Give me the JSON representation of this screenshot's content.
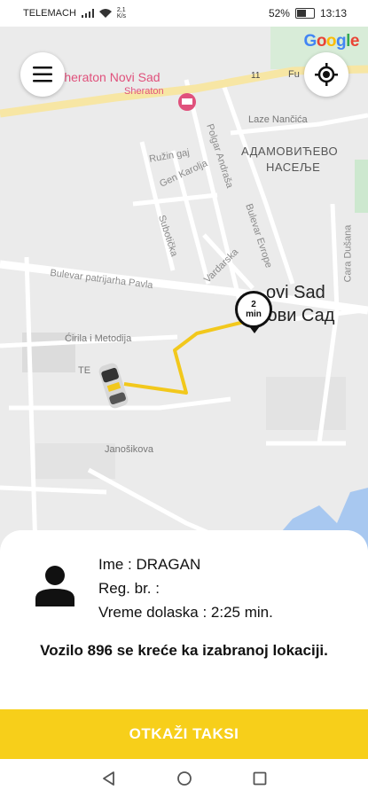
{
  "status_bar": {
    "carrier": "TELEMACH",
    "speed_value": "2,1",
    "speed_unit": "K/s",
    "battery": "52%",
    "time": "13:13"
  },
  "map": {
    "google_logo": {
      "letters": [
        {
          "char": "G",
          "color": "#4285F4"
        },
        {
          "char": "o",
          "color": "#EA4335"
        },
        {
          "char": "o",
          "color": "#FBBC05"
        },
        {
          "char": "g",
          "color": "#4285F4"
        },
        {
          "char": "l",
          "color": "#34A853"
        },
        {
          "char": "e",
          "color": "#EA4335"
        }
      ]
    },
    "labels": {
      "sheraton": "Sheraton Novi Sad",
      "sheraton_sub": "Sheraton",
      "road_number": "11",
      "fu": "Fu",
      "laze_nancica": "Laze Nančića",
      "district_line1": "АДАМОВИЋЕВО",
      "district_line2": "НАСЕЉЕ",
      "ruzin_gaj": "Ružin gaj",
      "gen_karolja": "Gen Karolja",
      "polgar_andrasa": "Polgar Andraša",
      "bulevar_evrope": "Bulevar Evrope",
      "subotica": "Subotička",
      "vardarska": "Vardarska",
      "cara_dusana": "Cara Dušana",
      "bulevar_patrijarha": "Bulevar patrijarha Pavla",
      "novi_sad_latin": "ovi Sad",
      "novi_sad_cyrillic": "Нови Сад",
      "cirila_metodija": "Ćirila i Metodija",
      "te": "ТЕ",
      "janosikova": "Janošikova"
    },
    "eta": {
      "value": "2",
      "unit": "min"
    },
    "route_color": "#f2c81c",
    "menu_icon": "hamburger-menu-icon",
    "locate_icon": "crosshair-location-icon"
  },
  "driver": {
    "name_line": "Ime : DRAGAN",
    "reg_line": "Reg. br. :",
    "arrival_line": "Vreme dolaska : 2:25 min."
  },
  "message": "Vozilo 896 se kreće ka izabranoj lokaciji.",
  "cancel_button": {
    "label": "OTKAŽI TAKSI",
    "color": "#f7cf1a"
  },
  "nav_bar": {
    "icons": [
      "back-icon",
      "home-icon",
      "recents-icon"
    ]
  }
}
